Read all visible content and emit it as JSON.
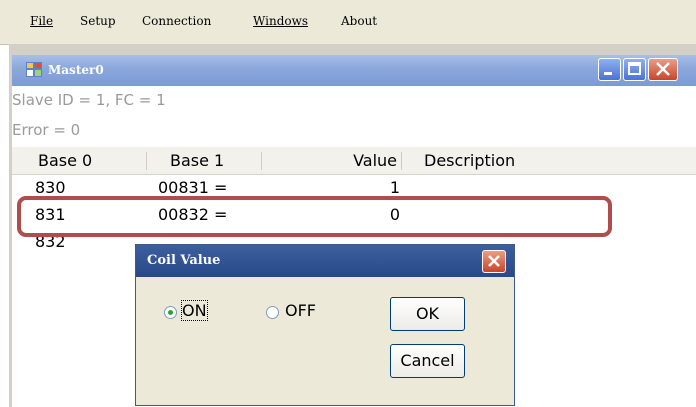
{
  "menu": {
    "file": "File",
    "setup": "Setup",
    "connection": "Connection",
    "windows": "Windows",
    "about": "About"
  },
  "window": {
    "title": "Master0",
    "icon": "app-window-icon",
    "minimize_icon": "minimize-icon",
    "maximize_icon": "maximize-icon",
    "close_icon": "close-icon"
  },
  "info": {
    "line1": "Slave ID = 1, FC = 1",
    "line2": "Error = 0"
  },
  "table": {
    "columns": [
      "Base 0",
      "Base 1",
      "Value",
      "Description"
    ],
    "rows": [
      {
        "base0": "830",
        "base1": "00831 =",
        "value": "1",
        "description": ""
      },
      {
        "base0": "831",
        "base1": "00832 =",
        "value": "0",
        "description": ""
      },
      {
        "base0": "832",
        "base1": "",
        "value": "",
        "description": ""
      }
    ],
    "highlight_color": "#b04c4c"
  },
  "dialog": {
    "title": "Coil Value",
    "close_icon": "close-icon",
    "on_label": "ON",
    "off_label": "OFF",
    "selected": "ON",
    "ok_label": "OK",
    "cancel_label": "Cancel"
  },
  "colors": {
    "accent_radio": "#2fa12f",
    "dialog_title": "#274a87",
    "window_title": "#7c9ad6"
  }
}
